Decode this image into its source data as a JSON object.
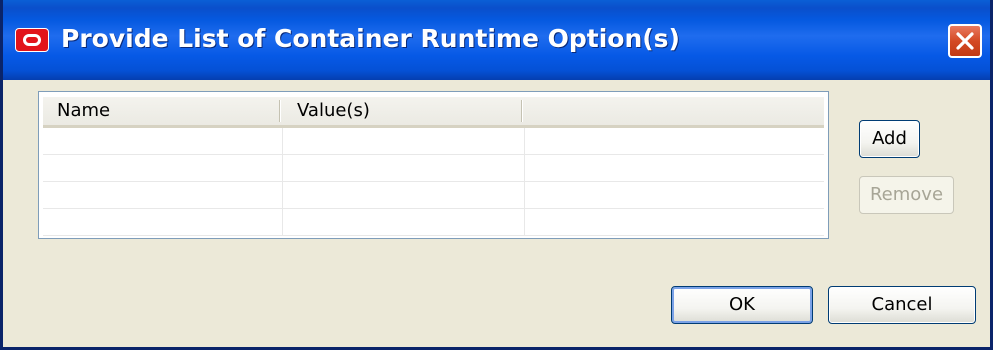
{
  "dialog": {
    "title": "Provide List of Container Runtime Option(s)",
    "ok_label": "OK",
    "cancel_label": "Cancel"
  },
  "table": {
    "columns": [
      "Name",
      "Value(s)",
      ""
    ],
    "rows": [
      [
        "",
        "",
        ""
      ],
      [
        "",
        "",
        ""
      ],
      [
        "",
        "",
        ""
      ],
      [
        "",
        "",
        ""
      ]
    ]
  },
  "side_buttons": {
    "add_label": "Add",
    "remove_label": "Remove",
    "remove_enabled": false
  },
  "colors": {
    "titlebar": "#0559e0",
    "dialog_bg": "#ece9d8",
    "close_button": "#d44a24",
    "app_icon": "#e2141a"
  },
  "icons": {
    "app": "oracle-logo-icon",
    "close": "close-icon"
  }
}
